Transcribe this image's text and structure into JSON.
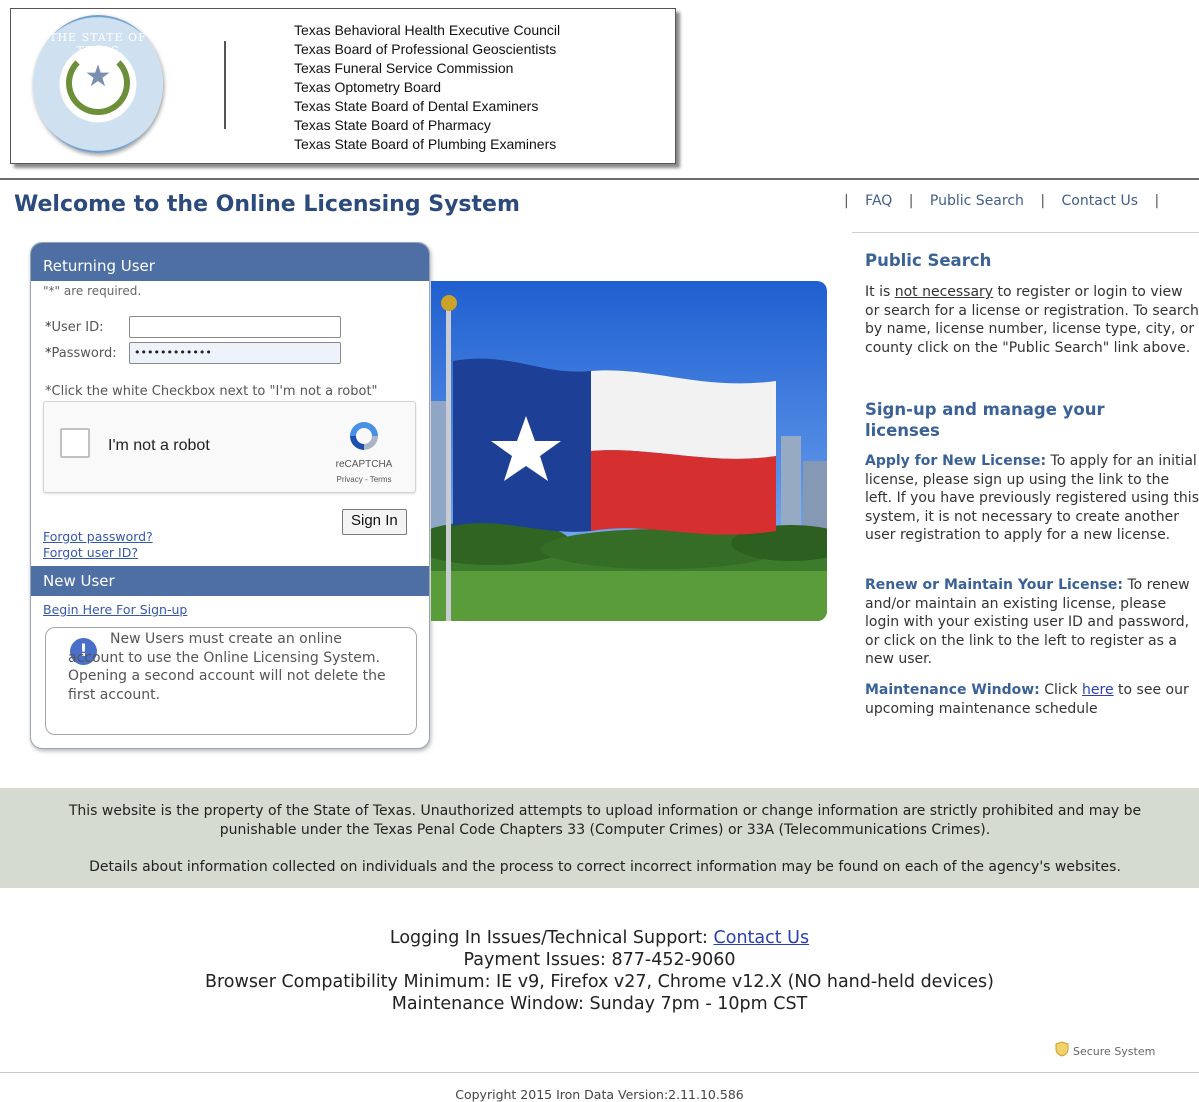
{
  "header": {
    "seal_text": "THE STATE OF TEXAS",
    "agencies": [
      "Texas Behavioral Health Executive Council",
      "Texas Board of Professional Geoscientists",
      "Texas Funeral Service Commission",
      "Texas Optometry Board",
      "Texas State Board of Dental Examiners",
      "Texas State Board of Pharmacy",
      "Texas State Board of Plumbing Examiners"
    ]
  },
  "page_title": "Welcome to the Online Licensing System",
  "nav": {
    "faq": "FAQ",
    "public_search": "Public Search",
    "contact_us": "Contact Us"
  },
  "login": {
    "returning_user_heading": "Returning User",
    "required_note": "\"*\" are required.",
    "user_id_label": "User ID:",
    "user_id_value": "",
    "password_label": "Password:",
    "password_value": "••••••••••••",
    "captcha_note": "*Click the white Checkbox next to \"I'm not a robot\"",
    "captcha_label": "I'm not a robot",
    "captcha_brand": "reCAPTCHA",
    "captcha_terms": "Privacy - Terms",
    "sign_in": "Sign In",
    "forgot_password": "Forgot password?",
    "forgot_user_id": "Forgot user ID?",
    "new_user_heading": "New User",
    "begin_signup": "Begin Here For Sign-up",
    "notice": "New Users must create an online account to use the Online Licensing System. Opening a second account will not delete the first account."
  },
  "sidebar": {
    "public_search_heading": "Public Search",
    "ps_text_1": "It is ",
    "ps_not_necessary": "not necessary",
    "ps_text_2": " to register or login to view or search for a license or registration. To search by name, license number, license type, city, or county click on the \"Public Search\" link above.",
    "signup_heading": "Sign-up and manage your licenses",
    "apply_label": "Apply for New License:",
    "apply_text": " To apply for an initial license, please sign up using the link to the left. If you have previously registered using this system, it is not necessary to create another user registration to apply for a new license.",
    "renew_label": "Renew or Maintain Your License:",
    "renew_text": " To renew and/or maintain an existing license, please login with your existing user ID and password, or click on the link to the left to register as a new user.",
    "maint_label": "Maintenance Window:",
    "maint_text_1": " Click ",
    "maint_link": "here",
    "maint_text_2": " to see our upcoming maintenance schedule"
  },
  "legal": {
    "para1": "This website is the property of the State of Texas. Unauthorized attempts to upload information or change information are strictly prohibited and may be punishable under the Texas Penal Code Chapters 33 (Computer Crimes) or 33A (Telecommunications Crimes).",
    "para2": "Details about information collected on individuals and the process to correct incorrect information may be found on each of the agency's websites."
  },
  "support": {
    "login_issues": "Logging In Issues/Technical Support: ",
    "contact_link": "Contact Us",
    "payment": "Payment Issues: 877-452-9060",
    "browser": "Browser Compatibility Minimum: IE v9, Firefox v27, Chrome v12.X (NO hand-held devices)",
    "maintenance": "Maintenance Window: Sunday 7pm - 10pm CST"
  },
  "secure_label": "Secure System",
  "copyright": "Copyright 2015 Iron Data Version:2.11.10.586",
  "colors": {
    "brand_blue": "#4d6fa3",
    "heading_blue": "#2c4a7c",
    "link_blue": "#3658a8",
    "legal_band": "#d5dbd0"
  }
}
